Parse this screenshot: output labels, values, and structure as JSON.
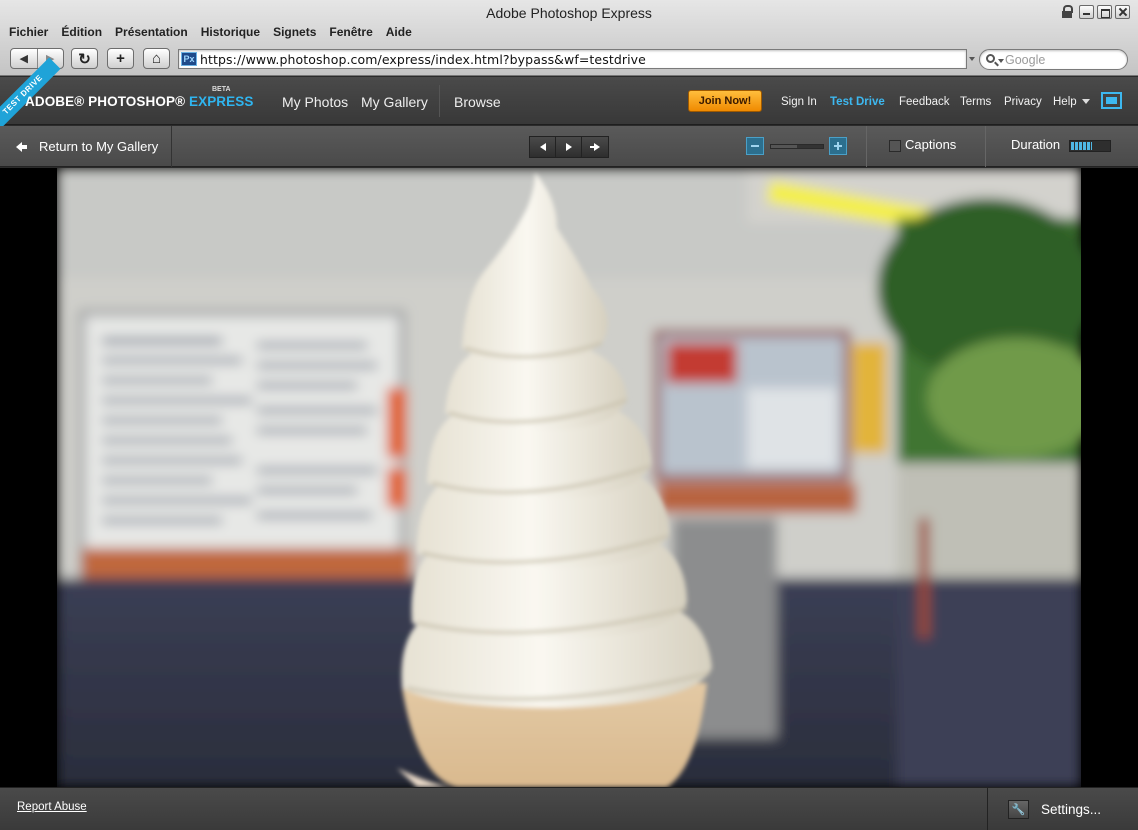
{
  "window": {
    "title": "Adobe Photoshop Express"
  },
  "menubar": {
    "items": [
      "Fichier",
      "Édition",
      "Présentation",
      "Historique",
      "Signets",
      "Fenêtre",
      "Aide"
    ]
  },
  "toolbar": {
    "back_icon": "back-arrow-icon",
    "forward_icon": "forward-arrow-icon",
    "url": "https://www.photoshop.com/express/index.html?bypass&wf=testdrive",
    "favicon_text": "Px",
    "search_placeholder": "Google"
  },
  "app": {
    "ribbon": "TEST DRIVE",
    "logo_main": "ADOBE® PHOTOSHOP®",
    "logo_accent": "EXPRESS",
    "logo_badge": "BETA",
    "nav": {
      "my_photos": "My Photos",
      "my_gallery": "My Gallery",
      "browse": "Browse"
    },
    "join": "Join Now!",
    "links": {
      "sign_in": "Sign In",
      "test_drive": "Test Drive",
      "feedback": "Feedback",
      "terms": "Terms",
      "privacy": "Privacy",
      "help": "Help"
    },
    "colors": {
      "accent": "#3db8f0",
      "join": "#f39c12"
    }
  },
  "viewer": {
    "return_label": "Return to My Gallery",
    "captions_label": "Captions",
    "captions_checked": false,
    "duration_label": "Duration",
    "duration_level": 0.55,
    "zoom_level": 0.5,
    "photo_subject": "soft-serve ice cream cone in front of an ice cream stand"
  },
  "footer": {
    "report_abuse": "Report Abuse",
    "settings": "Settings..."
  }
}
